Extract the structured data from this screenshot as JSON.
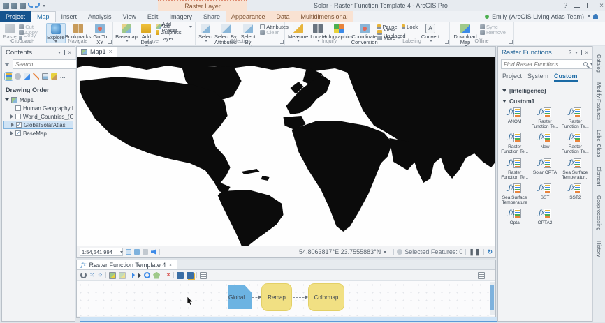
{
  "titlebar": {
    "contextual_group_label": "Raster Layer",
    "window_title": "Solar - Raster Function Template 4 - ArcGIS Pro",
    "help_label": "?"
  },
  "ribbon": {
    "tabs": [
      {
        "label": "Project"
      },
      {
        "label": "Map"
      },
      {
        "label": "Insert"
      },
      {
        "label": "Analysis"
      },
      {
        "label": "View"
      },
      {
        "label": "Edit"
      },
      {
        "label": "Imagery"
      },
      {
        "label": "Share"
      },
      {
        "label": "Appearance"
      },
      {
        "label": "Data"
      },
      {
        "label": "Multidimensional"
      }
    ],
    "active_tab": "Map",
    "user_label": "Emily (ArcGIS Living Atlas Team)",
    "groups": {
      "clipboard": {
        "label": "Clipboard",
        "paste": "Paste",
        "cut": "Cut",
        "copy": "Copy",
        "copy_path": "Copy Path"
      },
      "navigate": {
        "label": "Navigate",
        "explore": "Explore",
        "bookmarks": "Bookmarks",
        "goto_xy": "Go To XY"
      },
      "layer": {
        "label": "Layer",
        "basemap": "Basemap",
        "add_data": "Add Data",
        "add_preset": "Add Preset",
        "add_graphics": "Add Graphics Layer"
      },
      "selection": {
        "label": "Selection",
        "select": "Select",
        "by_attributes": "Select By Attributes",
        "by_location": "Select By Location",
        "attributes": "Attributes",
        "clear": "Clear"
      },
      "inquiry": {
        "label": "Inquiry",
        "measure": "Measure",
        "locate": "Locate",
        "infographics": "Infographics",
        "coord": "Coordinate Conversion"
      },
      "labeling": {
        "label": "Labeling",
        "pause": "Pause",
        "lock": "Lock",
        "view_unplaced": "View Unplaced",
        "more": "More",
        "convert": "Convert"
      },
      "offline": {
        "label": "Offline",
        "download": "Download Map",
        "sync": "Sync",
        "remove": "Remove"
      }
    }
  },
  "contents": {
    "title": "Contents",
    "search_placeholder": "Search",
    "drawing_order_label": "Drawing Order",
    "map_name": "Map1",
    "layers": [
      {
        "name": "Human Geography Label",
        "checked": false,
        "selected": false
      },
      {
        "name": "World_Countries_(Generalized)",
        "checked": false,
        "selected": false
      },
      {
        "name": "GlobalSolarAtlas",
        "checked": true,
        "selected": true
      },
      {
        "name": "BaseMap",
        "checked": true,
        "selected": false
      }
    ]
  },
  "map": {
    "tab_label": "Map1",
    "scale": "1:54,641,994",
    "coordinates": "54.8063817°E 23.7555883°N",
    "selected_features_label": "Selected Features: 0"
  },
  "template_editor": {
    "tab_label": "Raster Function Template 4",
    "nodes": [
      {
        "label": "Global ...",
        "type": "raster-input",
        "color": "#6cb3e2"
      },
      {
        "label": "Remap",
        "type": "function",
        "color": "#f1e083"
      },
      {
        "label": "Colormap",
        "type": "function",
        "color": "#f1e083"
      }
    ]
  },
  "raster_functions": {
    "title": "Raster Functions",
    "search_placeholder": "Find Raster Functions",
    "tabs": [
      "Project",
      "System",
      "Custom"
    ],
    "active_tab": "Custom",
    "sections": [
      {
        "name": "[Intelligence]",
        "items": []
      },
      {
        "name": "Custom1",
        "items": [
          "ANOM",
          "Raster Function Te...",
          "Raster Function Te...",
          "Raster Function Te...",
          "New",
          "Raster Function Te...",
          "Raster Function Te...",
          "Solar OPTA",
          "Sea Surface Temperatur...",
          "Sea Surface Temperature",
          "SST",
          "SST2",
          "Opta",
          "OPTA2"
        ]
      }
    ]
  },
  "right_dock": {
    "tabs": [
      "Catalog",
      "Modify Features",
      "Label Class",
      "Element",
      "Geoprocessing",
      "History"
    ]
  }
}
